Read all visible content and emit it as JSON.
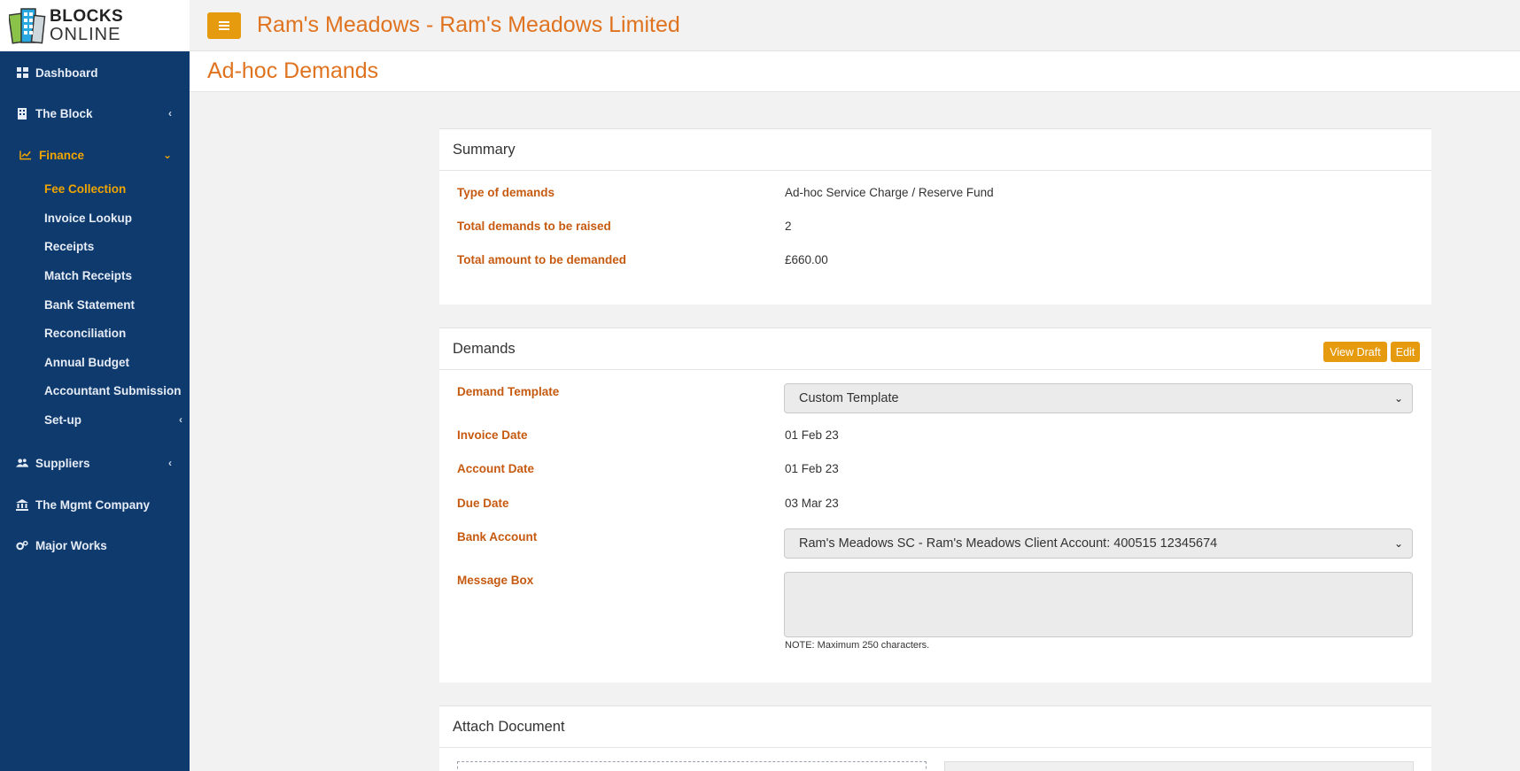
{
  "logo": {
    "line1": "BLOCKS",
    "line2": "ONLINE"
  },
  "header": {
    "title": "Ram's Meadows - Ram's Meadows Limited"
  },
  "page": {
    "title": "Ad-hoc Demands"
  },
  "sidebar": {
    "items": [
      {
        "label": "Dashboard",
        "icon": "dashboard-icon"
      },
      {
        "label": "The Block",
        "icon": "building-icon"
      },
      {
        "label": "Finance",
        "icon": "chart-line-icon"
      },
      {
        "label": "Suppliers",
        "icon": "users-icon"
      },
      {
        "label": "The Mgmt Company",
        "icon": "bank-icon"
      },
      {
        "label": "Major Works",
        "icon": "cogs-icon"
      }
    ],
    "finance_sub": [
      "Fee Collection",
      "Invoice Lookup",
      "Receipts",
      "Match Receipts",
      "Bank Statement",
      "Reconciliation",
      "Annual Budget",
      "Accountant Submission",
      "Set-up"
    ]
  },
  "summary": {
    "title": "Summary",
    "rows": [
      {
        "label": "Type of demands",
        "value": "Ad-hoc Service Charge / Reserve Fund"
      },
      {
        "label": "Total demands to be raised",
        "value": "2"
      },
      {
        "label": "Total amount to be demanded",
        "value": "£660.00"
      }
    ]
  },
  "demands": {
    "title": "Demands",
    "view_draft_label": "View Draft",
    "edit_label": "Edit",
    "template_label": "Demand Template",
    "template_value": "Custom Template",
    "invoice_date_label": "Invoice Date",
    "invoice_date": "01 Feb 23",
    "account_date_label": "Account Date",
    "account_date": "01 Feb 23",
    "due_date_label": "Due Date",
    "due_date": "03 Mar 23",
    "bank_account_label": "Bank Account",
    "bank_account_value": "Ram's Meadows SC - Ram's Meadows Client Account: 400515 12345674",
    "message_label": "Message Box",
    "message_note": "NOTE: Maximum 250 characters."
  },
  "attach": {
    "title": "Attach Document"
  },
  "colors": {
    "sidebar": "#0f3a6e",
    "accent": "#e69a0d",
    "title": "#e0731f",
    "label": "#c65a10",
    "active": "#f0a500"
  }
}
